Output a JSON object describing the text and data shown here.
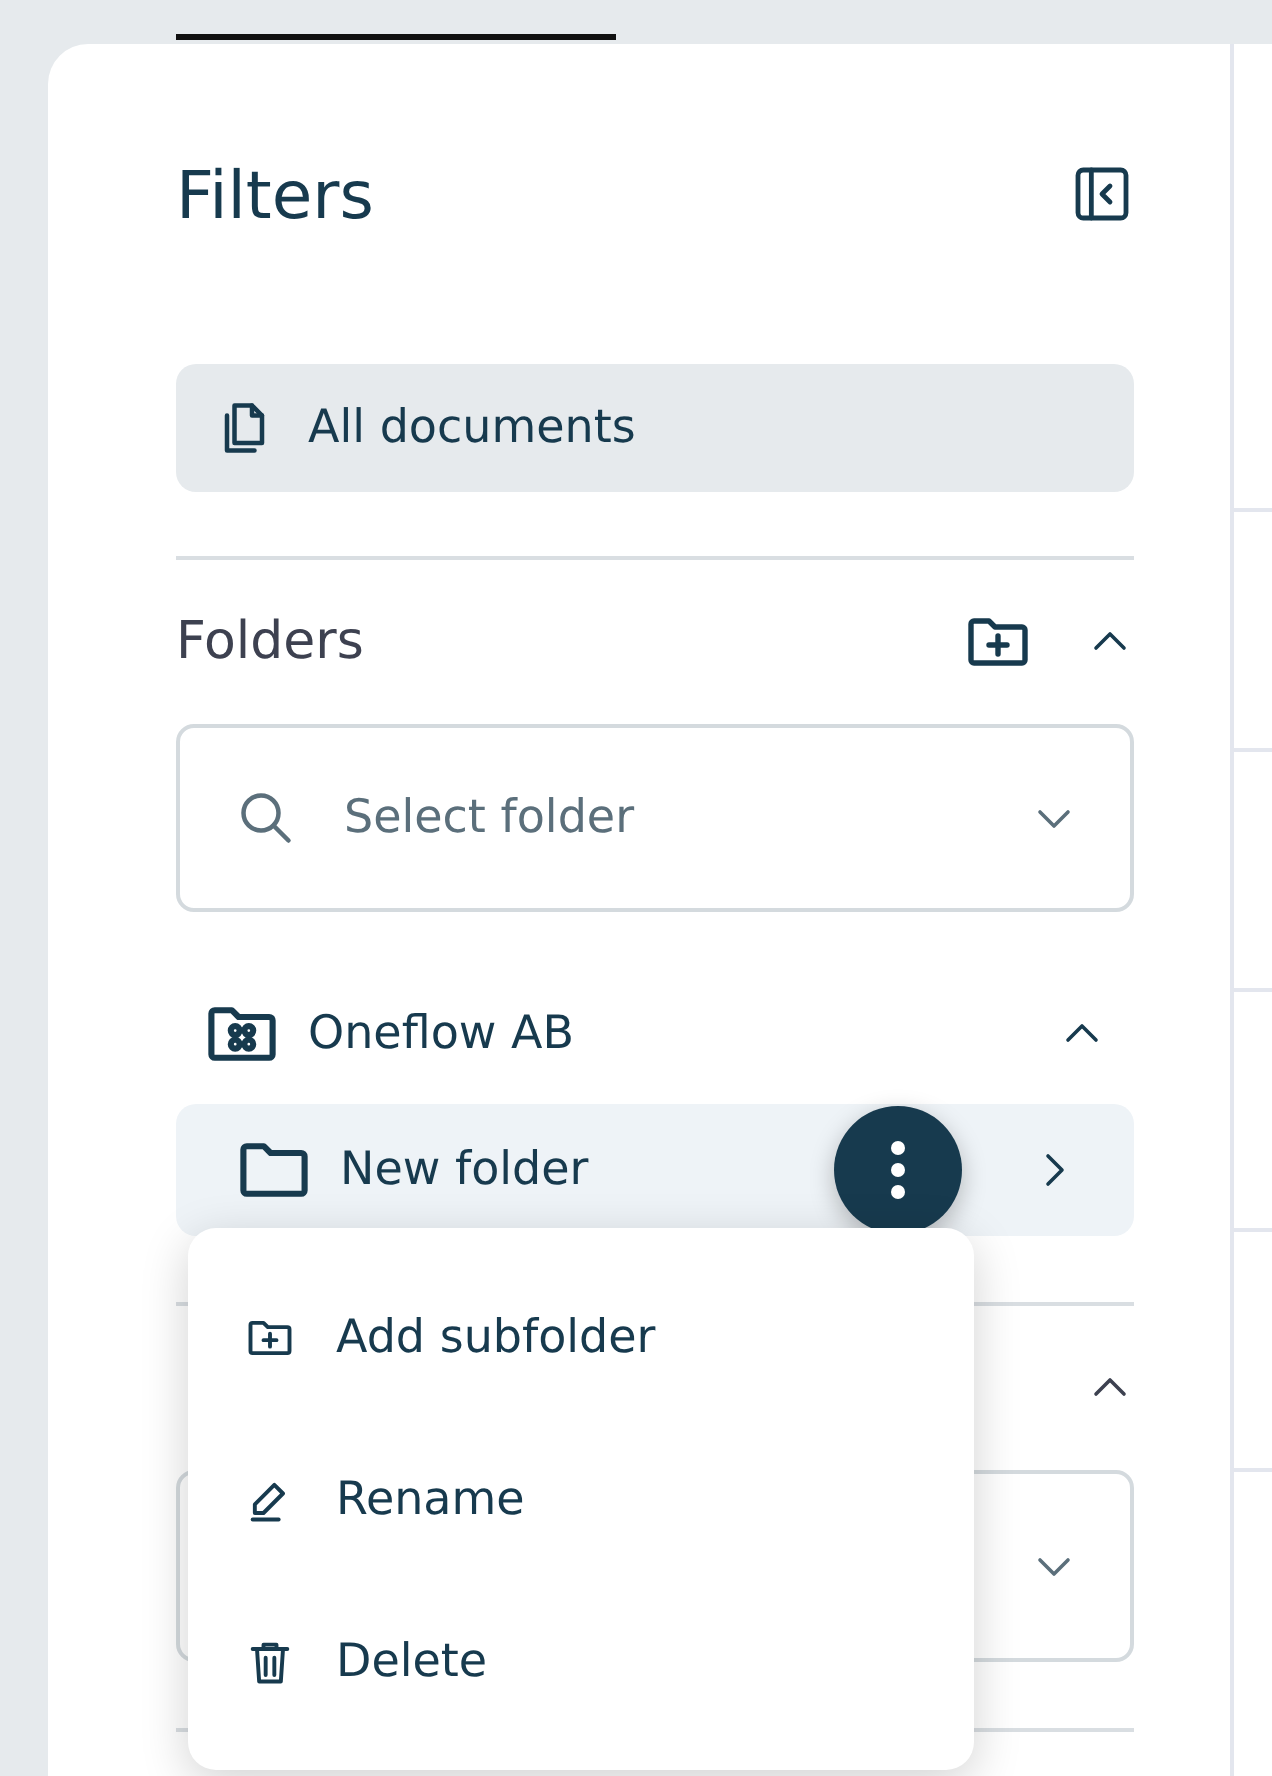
{
  "panel": {
    "title": "Filters",
    "all_documents": {
      "label": "All documents",
      "selected": true
    }
  },
  "folders": {
    "title": "Folders",
    "expanded": true,
    "search": {
      "placeholder": "Select folder"
    },
    "tree": [
      {
        "label": "Oneflow AB",
        "kind": "workspace",
        "expanded": true,
        "children": [
          {
            "label": "New folder",
            "kind": "folder",
            "selected": true
          }
        ]
      }
    ]
  },
  "second_section": {
    "expanded": true
  },
  "context_menu": [
    {
      "label": "Add subfolder",
      "kind": "add"
    },
    {
      "label": "Rename",
      "kind": "rename"
    },
    {
      "label": "Delete",
      "kind": "delete"
    }
  ]
}
